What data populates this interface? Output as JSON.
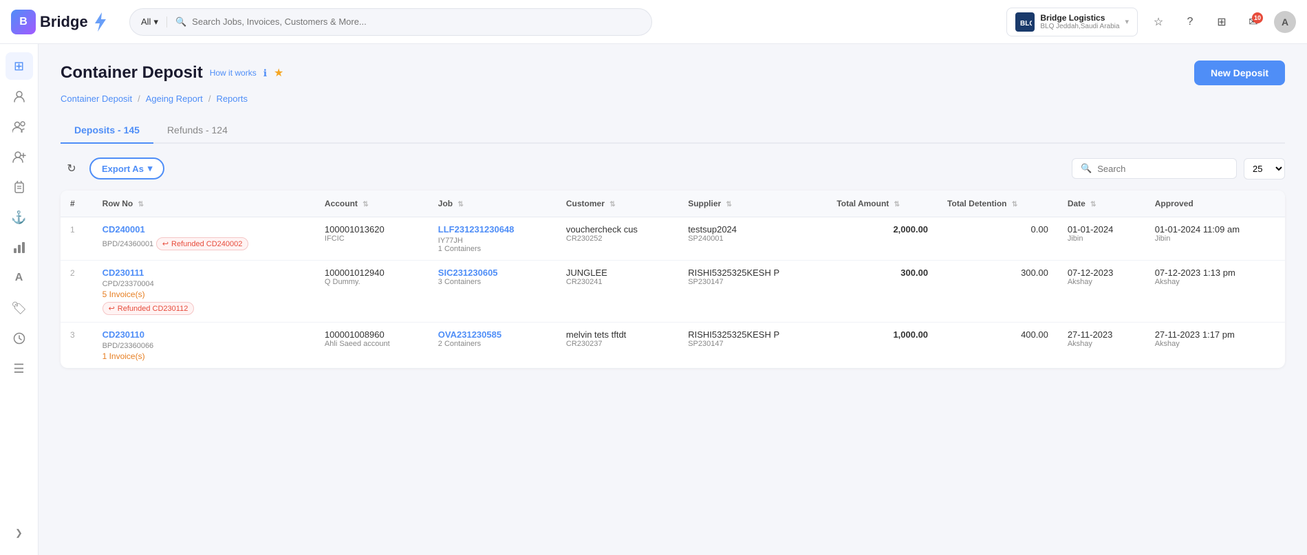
{
  "app": {
    "name": "Bridge",
    "logo_letter": "B"
  },
  "topnav": {
    "search_placeholder": "Search Jobs, Invoices, Customers & More...",
    "search_filter": "All",
    "company": {
      "name": "Bridge Logistics",
      "sub": "BLQ Jeddah,Saudi Arabia"
    },
    "notification_count": "10",
    "avatar_initial": "A"
  },
  "page": {
    "title": "Container Deposit",
    "how_it_works": "How it works",
    "new_deposit_label": "New Deposit"
  },
  "breadcrumb": {
    "items": [
      "Container Deposit",
      "Ageing Report",
      "Reports"
    ]
  },
  "tabs": [
    {
      "label": "Deposits - 145",
      "active": true
    },
    {
      "label": "Refunds - 124",
      "active": false
    }
  ],
  "toolbar": {
    "export_label": "Export As",
    "search_placeholder": "Search",
    "page_size": "25"
  },
  "table": {
    "columns": [
      "#",
      "Row No",
      "Account",
      "Job",
      "Customer",
      "Supplier",
      "Total Amount",
      "Total Detention",
      "Date",
      "Approved"
    ],
    "rows": [
      {
        "num": "1",
        "row_no": "CD240001",
        "bpd": "BPD/24360001",
        "refund_badge": "Refunded CD240002",
        "account": "100001013620",
        "account_sub": "IFCIC",
        "job": "LLF231231230648",
        "job_sub": "IY77JH",
        "job_containers": "1 Containers",
        "customer": "vouchercheck cus",
        "customer_ref": "CR230252",
        "supplier": "testsup2024",
        "supplier_ref": "SP240001",
        "total_amount": "2,000.00",
        "total_detention": "0.00",
        "date": "01-01-2024",
        "approved": "01-01-2024 11:09 am",
        "approved_user": "Jibin",
        "date_user": "Jibin",
        "has_refund": true,
        "has_invoice": false,
        "invoice_label": ""
      },
      {
        "num": "2",
        "row_no": "CD230111",
        "bpd": "CPD/23370004",
        "refund_badge": "Refunded CD230112",
        "account": "100001012940",
        "account_sub": "Q Dummy.",
        "job": "SIC231230605",
        "job_sub": "",
        "job_containers": "3 Containers",
        "customer": "JUNGLEE",
        "customer_ref": "CR230241",
        "supplier": "RISHI5325325KESH P",
        "supplier_ref": "SP230147",
        "total_amount": "300.00",
        "total_detention": "300.00",
        "date": "07-12-2023",
        "approved": "07-12-2023 1:13 pm",
        "approved_user": "Akshay",
        "date_user": "Akshay",
        "has_refund": true,
        "has_invoice": true,
        "invoice_label": "5 Invoice(s)"
      },
      {
        "num": "3",
        "row_no": "CD230110",
        "bpd": "BPD/23360066",
        "refund_badge": "",
        "account": "100001008960",
        "account_sub": "Ahli Saeed account",
        "job": "OVA231230585",
        "job_sub": "",
        "job_containers": "2 Containers",
        "customer": "melvin tets tftdt",
        "customer_ref": "CR230237",
        "supplier": "RISHI5325325KESH P",
        "supplier_ref": "SP230147",
        "total_amount": "1,000.00",
        "total_detention": "400.00",
        "date": "27-11-2023",
        "approved": "27-11-2023 1:17 pm",
        "approved_user": "Akshay",
        "date_user": "Akshay",
        "has_refund": false,
        "has_invoice": true,
        "invoice_label": "1 Invoice(s)"
      }
    ]
  },
  "sidebar": {
    "items": [
      {
        "icon": "⊞",
        "name": "grid"
      },
      {
        "icon": "👤",
        "name": "user"
      },
      {
        "icon": "👥",
        "name": "users"
      },
      {
        "icon": "👤+",
        "name": "user-add"
      },
      {
        "icon": "📋",
        "name": "clipboard"
      },
      {
        "icon": "⚓",
        "name": "anchor"
      },
      {
        "icon": "📊",
        "name": "chart"
      },
      {
        "icon": "A",
        "name": "letter-a"
      },
      {
        "icon": "🏷",
        "name": "tag"
      },
      {
        "icon": "🕐",
        "name": "history"
      },
      {
        "icon": "☰",
        "name": "menu"
      }
    ]
  }
}
